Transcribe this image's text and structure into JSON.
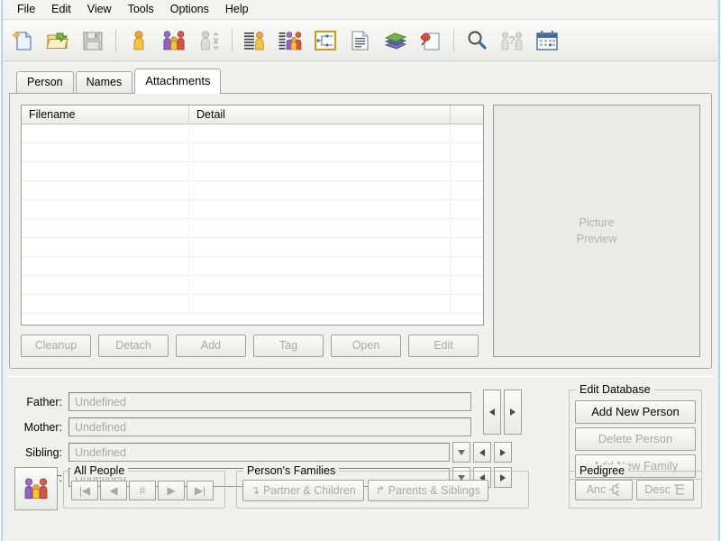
{
  "menubar": {
    "items": [
      {
        "label": "File"
      },
      {
        "label": "Edit"
      },
      {
        "label": "View"
      },
      {
        "label": "Tools"
      },
      {
        "label": "Options"
      },
      {
        "label": "Help"
      }
    ]
  },
  "toolbar": {
    "buttons": [
      {
        "icon": "new-file-icon",
        "enabled": true
      },
      {
        "icon": "open-folder-icon",
        "enabled": true
      },
      {
        "icon": "save-icon",
        "enabled": false
      },
      {
        "icon": "person-icon",
        "enabled": true
      },
      {
        "icon": "family-group-icon",
        "enabled": true
      },
      {
        "icon": "person-swap-icon",
        "enabled": false
      },
      {
        "icon": "person-list-icon",
        "enabled": true
      },
      {
        "icon": "family-list-icon",
        "enabled": true
      },
      {
        "icon": "tree-chart-icon",
        "enabled": true
      },
      {
        "icon": "report-document-icon",
        "enabled": true
      },
      {
        "icon": "books-icon",
        "enabled": true
      },
      {
        "icon": "pin-note-icon",
        "enabled": true
      },
      {
        "icon": "search-icon",
        "enabled": true
      },
      {
        "icon": "unknown-people-icon",
        "enabled": false
      },
      {
        "icon": "calendar-icon",
        "enabled": true
      }
    ]
  },
  "tabs": [
    {
      "label": "Person",
      "active": false
    },
    {
      "label": "Names",
      "active": false
    },
    {
      "label": "Attachments",
      "active": true
    }
  ],
  "attachments": {
    "columns": [
      {
        "label": "Filename"
      },
      {
        "label": "Detail"
      },
      {
        "label": ""
      }
    ],
    "rows": [],
    "row_count": 9,
    "buttons": [
      {
        "label": "Cleanup",
        "enabled": false
      },
      {
        "label": "Detach",
        "enabled": false
      },
      {
        "label": "Add",
        "enabled": false
      },
      {
        "label": "Tag",
        "enabled": false
      },
      {
        "label": "Open",
        "enabled": false
      },
      {
        "label": "Edit",
        "enabled": false
      }
    ],
    "preview": {
      "line1": "Picture",
      "line2": "Preview"
    }
  },
  "relations": {
    "rows": [
      {
        "label": "Father:",
        "value": "Undefined",
        "has_dropdown": false
      },
      {
        "label": "Mother:",
        "value": "Undefined",
        "has_dropdown": false
      },
      {
        "label": "Sibling:",
        "value": "Undefined",
        "has_dropdown": true
      },
      {
        "label": "Partner:",
        "value": "Undefined",
        "has_dropdown": true
      }
    ]
  },
  "edit_database": {
    "title": "Edit Database",
    "buttons": [
      {
        "label": "Add New Person",
        "enabled": true
      },
      {
        "label": "Delete Person",
        "enabled": false
      },
      {
        "label": "Add New Family",
        "enabled": false
      }
    ]
  },
  "all_people": {
    "title": "All People",
    "buttons": [
      {
        "glyph": "|◀",
        "name": "first",
        "enabled": false
      },
      {
        "glyph": "◀",
        "name": "previous",
        "enabled": false
      },
      {
        "glyph": "#",
        "name": "goto-number",
        "enabled": false
      },
      {
        "glyph": "▶",
        "name": "next",
        "enabled": false
      },
      {
        "glyph": "▶|",
        "name": "last",
        "enabled": false
      }
    ]
  },
  "persons_families": {
    "title": "Person's Families",
    "buttons": [
      {
        "label": "↴ Partner & Children",
        "enabled": false
      },
      {
        "label": "↱ Parents & Siblings",
        "enabled": false
      }
    ]
  },
  "pedigree": {
    "title": "Pedigree",
    "buttons": [
      {
        "label": "Anc",
        "enabled": false
      },
      {
        "label": "Desc",
        "enabled": false
      }
    ]
  },
  "family_group_button": {
    "icon": "family-group-icon"
  },
  "colors": {
    "window_bg": "#f0f0ee",
    "toolbar_bg": "#f2f2f0",
    "grid_bg": "#ffffff",
    "preview_bg": "#eaeae6",
    "disabled_text": "#a9a9a4",
    "border": "#a0a09a",
    "accent_blue": "#3b6ea5"
  }
}
